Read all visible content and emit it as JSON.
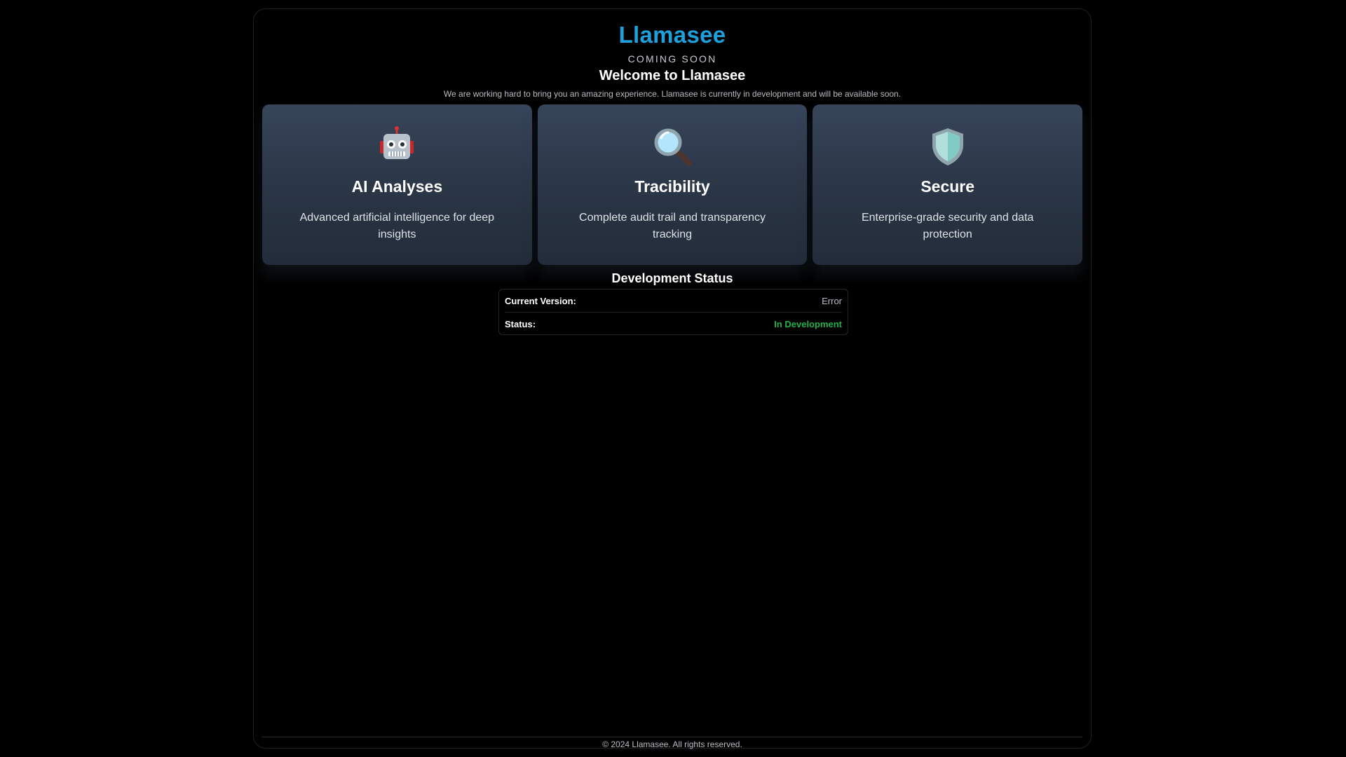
{
  "header": {
    "brand": "Llamasee",
    "tagline": "COMING SOON",
    "welcome": "Welcome to Llamasee",
    "intro": "We are working hard to bring you an amazing experience. Llamasee is currently in development and will be available soon."
  },
  "features": [
    {
      "icon": "robot-icon",
      "title": "AI Analyses",
      "description": "Advanced artificial intelligence for deep insights"
    },
    {
      "icon": "magnifying-glass-icon",
      "title": "Tracibility",
      "description": "Complete audit trail and transparency tracking"
    },
    {
      "icon": "shield-icon",
      "title": "Secure",
      "description": "Enterprise-grade security and data protection"
    }
  ],
  "dev_status": {
    "title": "Development Status",
    "rows": [
      {
        "label": "Current Version:",
        "value": "Error",
        "color": "#b8bcc2"
      },
      {
        "label": "Status:",
        "value": "In Development",
        "color": "#22b04a"
      }
    ]
  },
  "footer": {
    "copyright": "© 2024 Llamasee. All rights reserved."
  },
  "colors": {
    "brand": "#1ea0dc",
    "background": "#000000",
    "card": "#2e3a4b",
    "status_ok": "#22b04a"
  }
}
